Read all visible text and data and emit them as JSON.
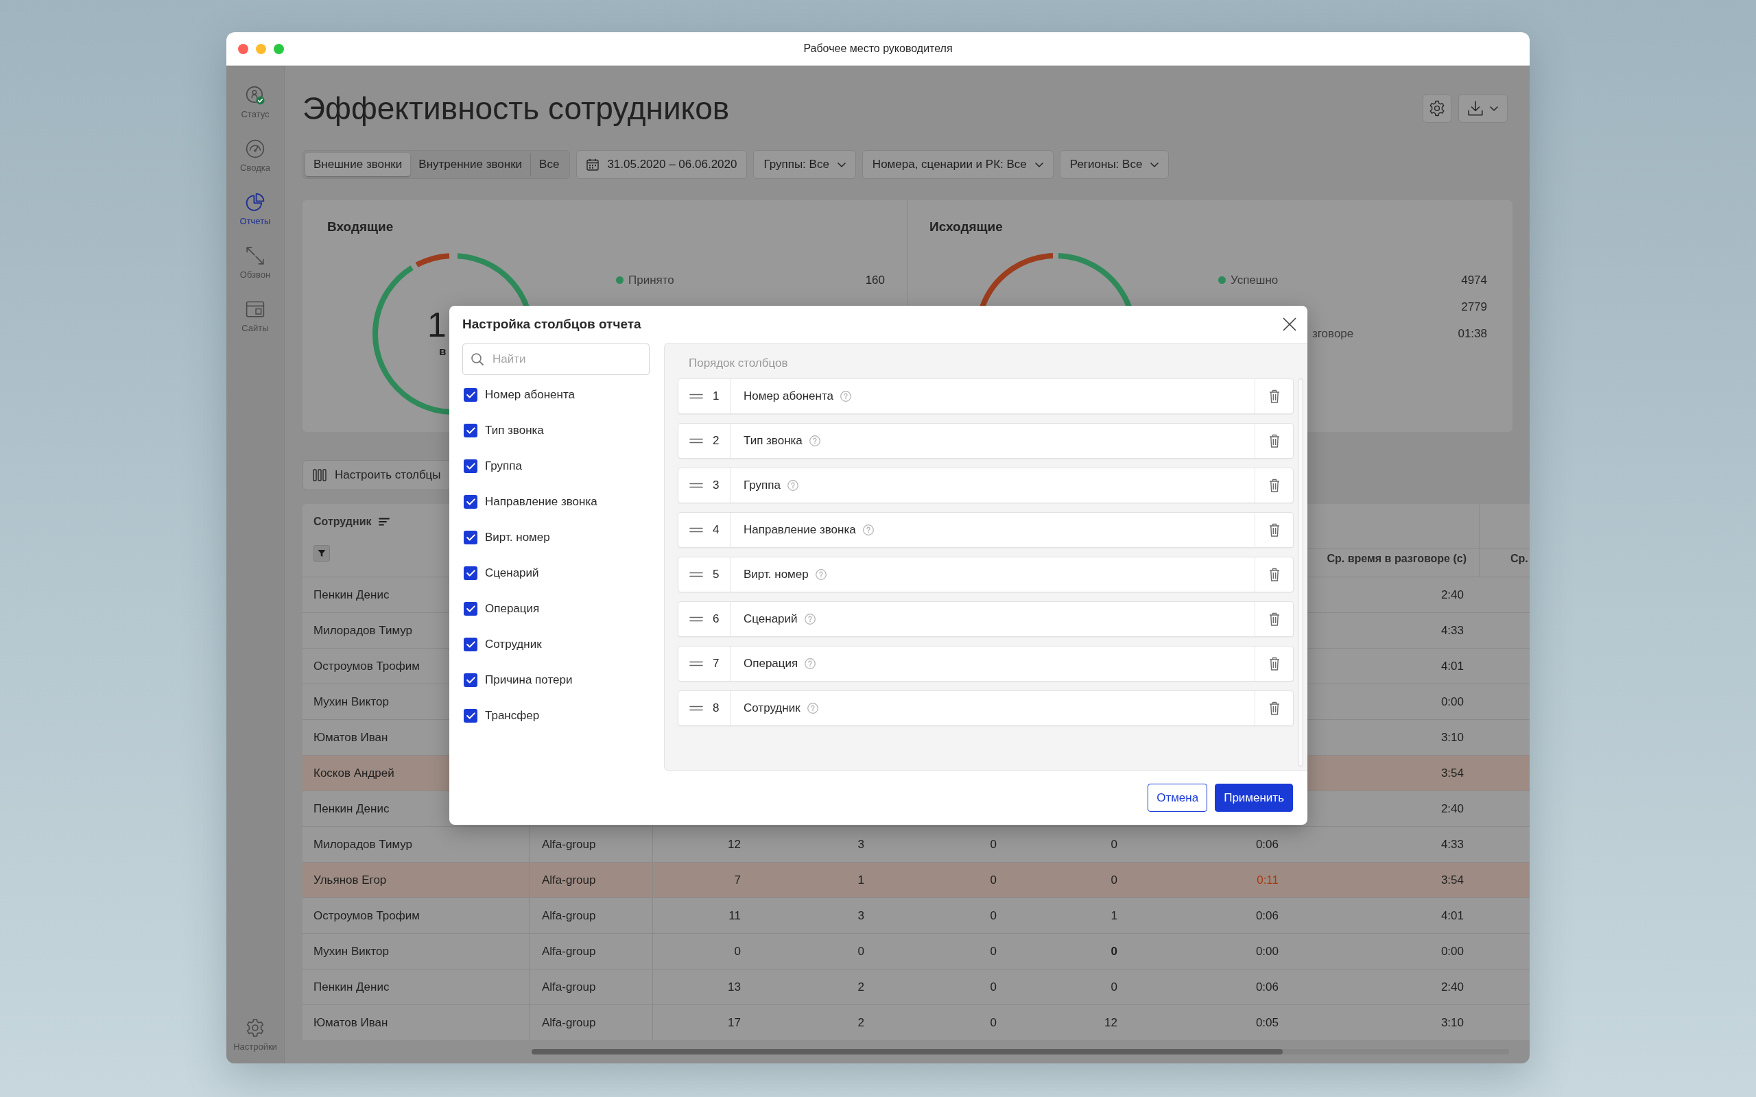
{
  "window": {
    "title": "Рабочее место руководителя"
  },
  "sidebar": {
    "items": [
      {
        "label": "Статус",
        "selected": false
      },
      {
        "label": "Сводка",
        "selected": false
      },
      {
        "label": "Отчеты",
        "selected": true
      },
      {
        "label": "Обзвон",
        "selected": false
      },
      {
        "label": "Сайты",
        "selected": false
      }
    ],
    "settings_item": {
      "label": "Настройки"
    }
  },
  "page_title": "Эффективность сотрудников",
  "filters": {
    "call_types": [
      {
        "label": "Внешние звонки",
        "selected": true
      },
      {
        "label": "Внутренние звонки",
        "selected": false
      },
      {
        "label": "Все",
        "selected": false
      }
    ],
    "date_range": "31.05.2020 – 06.06.2020",
    "dropdowns": [
      "Группы: Все",
      "Номера, сценарии и РК: Все",
      "Регионы: Все"
    ]
  },
  "stats": [
    {
      "title": "Входящие",
      "center_text": "1",
      "center_caption": "в",
      "legend": [
        {
          "label": "Принято",
          "value": "160",
          "color": "#2f8a5a"
        }
      ]
    },
    {
      "title": "Исходящие",
      "legend": [
        {
          "label": "Успешно",
          "value": "4974",
          "color": "#2f8a5a"
        },
        {
          "value": "2779"
        },
        {
          "label_tail": "зговоре",
          "value": "01:38"
        }
      ]
    }
  ],
  "columns_button": "Настроить столбцы",
  "table": {
    "columns": [
      {
        "label": "Сотрудник"
      },
      null,
      null,
      null,
      null,
      null,
      null,
      {
        "label": "Ср. время в разговоре (с)"
      },
      {
        "label": "Ср."
      }
    ],
    "rows": [
      {
        "highlighted": false,
        "cells": [
          "Пенкин Денис",
          null,
          null,
          null,
          null,
          null,
          null,
          "2:40"
        ]
      },
      {
        "highlighted": false,
        "cells": [
          "Милорадов Тимур",
          null,
          null,
          null,
          null,
          null,
          null,
          "4:33"
        ]
      },
      {
        "highlighted": false,
        "cells": [
          "Остроумов Трофим",
          null,
          null,
          null,
          null,
          null,
          null,
          "4:01"
        ]
      },
      {
        "highlighted": false,
        "cells": [
          "Мухин Виктор",
          null,
          null,
          null,
          null,
          null,
          null,
          "0:00"
        ]
      },
      {
        "highlighted": false,
        "cells": [
          "Юматов Иван",
          null,
          null,
          null,
          null,
          null,
          null,
          "3:10"
        ]
      },
      {
        "highlighted": true,
        "cells": [
          "Косков Андрей",
          null,
          null,
          null,
          null,
          null,
          null,
          "3:54"
        ]
      },
      {
        "highlighted": false,
        "cells": [
          "Пенкин Денис",
          null,
          null,
          null,
          null,
          null,
          null,
          "2:40"
        ]
      },
      {
        "highlighted": false,
        "cells": [
          "Милорадов Тимур",
          "Alfa-group",
          "12",
          "3",
          "0",
          "0",
          "0:06",
          "4:33"
        ]
      },
      {
        "highlighted": true,
        "cells": [
          "Ульянов Егор",
          "Alfa-group",
          "7",
          "1",
          "0",
          "0",
          {
            "text": "0:11",
            "kind": "alert"
          },
          "3:54"
        ]
      },
      {
        "highlighted": false,
        "cells": [
          "Остроумов Трофим",
          "Alfa-group",
          "11",
          "3",
          "0",
          "1",
          "0:06",
          "4:01"
        ]
      },
      {
        "highlighted": false,
        "cells": [
          "Мухин Виктор",
          "Alfa-group",
          "0",
          "0",
          "0",
          {
            "text": "0",
            "kind": "bold"
          },
          "0:00",
          "0:00"
        ]
      },
      {
        "highlighted": false,
        "cells": [
          "Пенкин Денис",
          "Alfa-group",
          "13",
          "2",
          "0",
          "0",
          "0:06",
          "2:40"
        ]
      },
      {
        "highlighted": false,
        "cells": [
          "Юматов Иван",
          "Alfa-group",
          "17",
          "2",
          "0",
          "12",
          "0:05",
          "3:10"
        ]
      }
    ]
  },
  "dialog": {
    "title": "Настройка столбцов отчета",
    "search": {
      "placeholder": "Найти"
    },
    "options": [
      {
        "label": "Номер абонента",
        "checked": true
      },
      {
        "label": "Тип звонка",
        "checked": true
      },
      {
        "label": "Группа",
        "checked": true
      },
      {
        "label": "Направление звонка",
        "checked": true
      },
      {
        "label": "Вирт. номер",
        "checked": true
      },
      {
        "label": "Сценарий",
        "checked": true
      },
      {
        "label": "Операция",
        "checked": true
      },
      {
        "label": "Сотрудник",
        "checked": true
      },
      {
        "label": "Причина потери",
        "checked": true
      },
      {
        "label": "Трансфер",
        "checked": true
      }
    ],
    "order_title": "Порядок столбцов",
    "order": [
      {
        "number": "1",
        "label": "Номер абонента"
      },
      {
        "number": "2",
        "label": "Тип звонка"
      },
      {
        "number": "3",
        "label": "Группа"
      },
      {
        "number": "4",
        "label": "Направление звонка"
      },
      {
        "number": "5",
        "label": "Вирт. номер"
      },
      {
        "number": "6",
        "label": "Сценарий"
      },
      {
        "number": "7",
        "label": "Операция"
      },
      {
        "number": "8",
        "label": "Сотрудник"
      }
    ],
    "buttons": [
      {
        "label": "Отмена",
        "kind": "secondary"
      },
      {
        "label": "Применить",
        "kind": "primary"
      }
    ]
  }
}
